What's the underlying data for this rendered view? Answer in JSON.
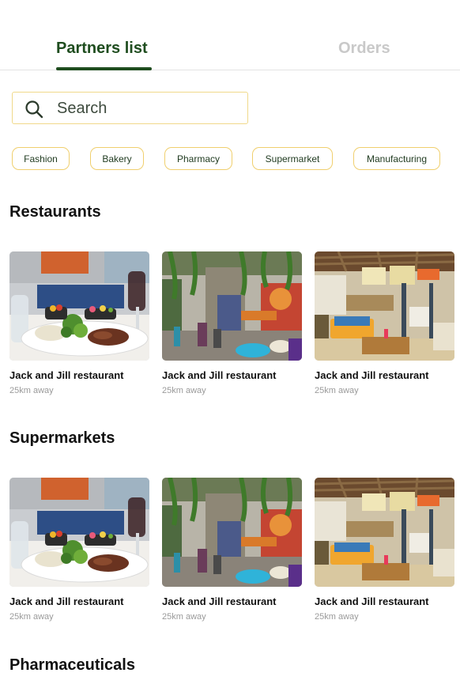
{
  "tabs": {
    "partners_label": "Partners list",
    "orders_label": "Orders"
  },
  "search": {
    "placeholder": "Search",
    "value": ""
  },
  "categories": [
    "Fashion",
    "Bakery",
    "Pharmacy",
    "Supermarket",
    "Manufacturing"
  ],
  "sections": [
    {
      "title": "Restaurants",
      "cards": [
        {
          "name": "Jack and Jill restaurant",
          "distance": "25km away",
          "image": "plated-steak-photo"
        },
        {
          "name": "Jack and Jill restaurant",
          "distance": "25km away",
          "image": "green-interior-photo"
        },
        {
          "name": "Jack and Jill restaurant",
          "distance": "25km away",
          "image": "patio-lounge-photo"
        }
      ]
    },
    {
      "title": "Supermarkets",
      "cards": [
        {
          "name": "Jack and Jill restaurant",
          "distance": "25km away",
          "image": "plated-steak-photo"
        },
        {
          "name": "Jack and Jill restaurant",
          "distance": "25km away",
          "image": "green-interior-photo"
        },
        {
          "name": "Jack and Jill restaurant",
          "distance": "25km away",
          "image": "patio-lounge-photo"
        }
      ]
    },
    {
      "title": "Pharmaceuticals",
      "cards": []
    }
  ],
  "colors": {
    "brand_green": "#1f4d1f",
    "chip_border": "#f0cf6e",
    "muted_tab": "#c9c9c9"
  }
}
